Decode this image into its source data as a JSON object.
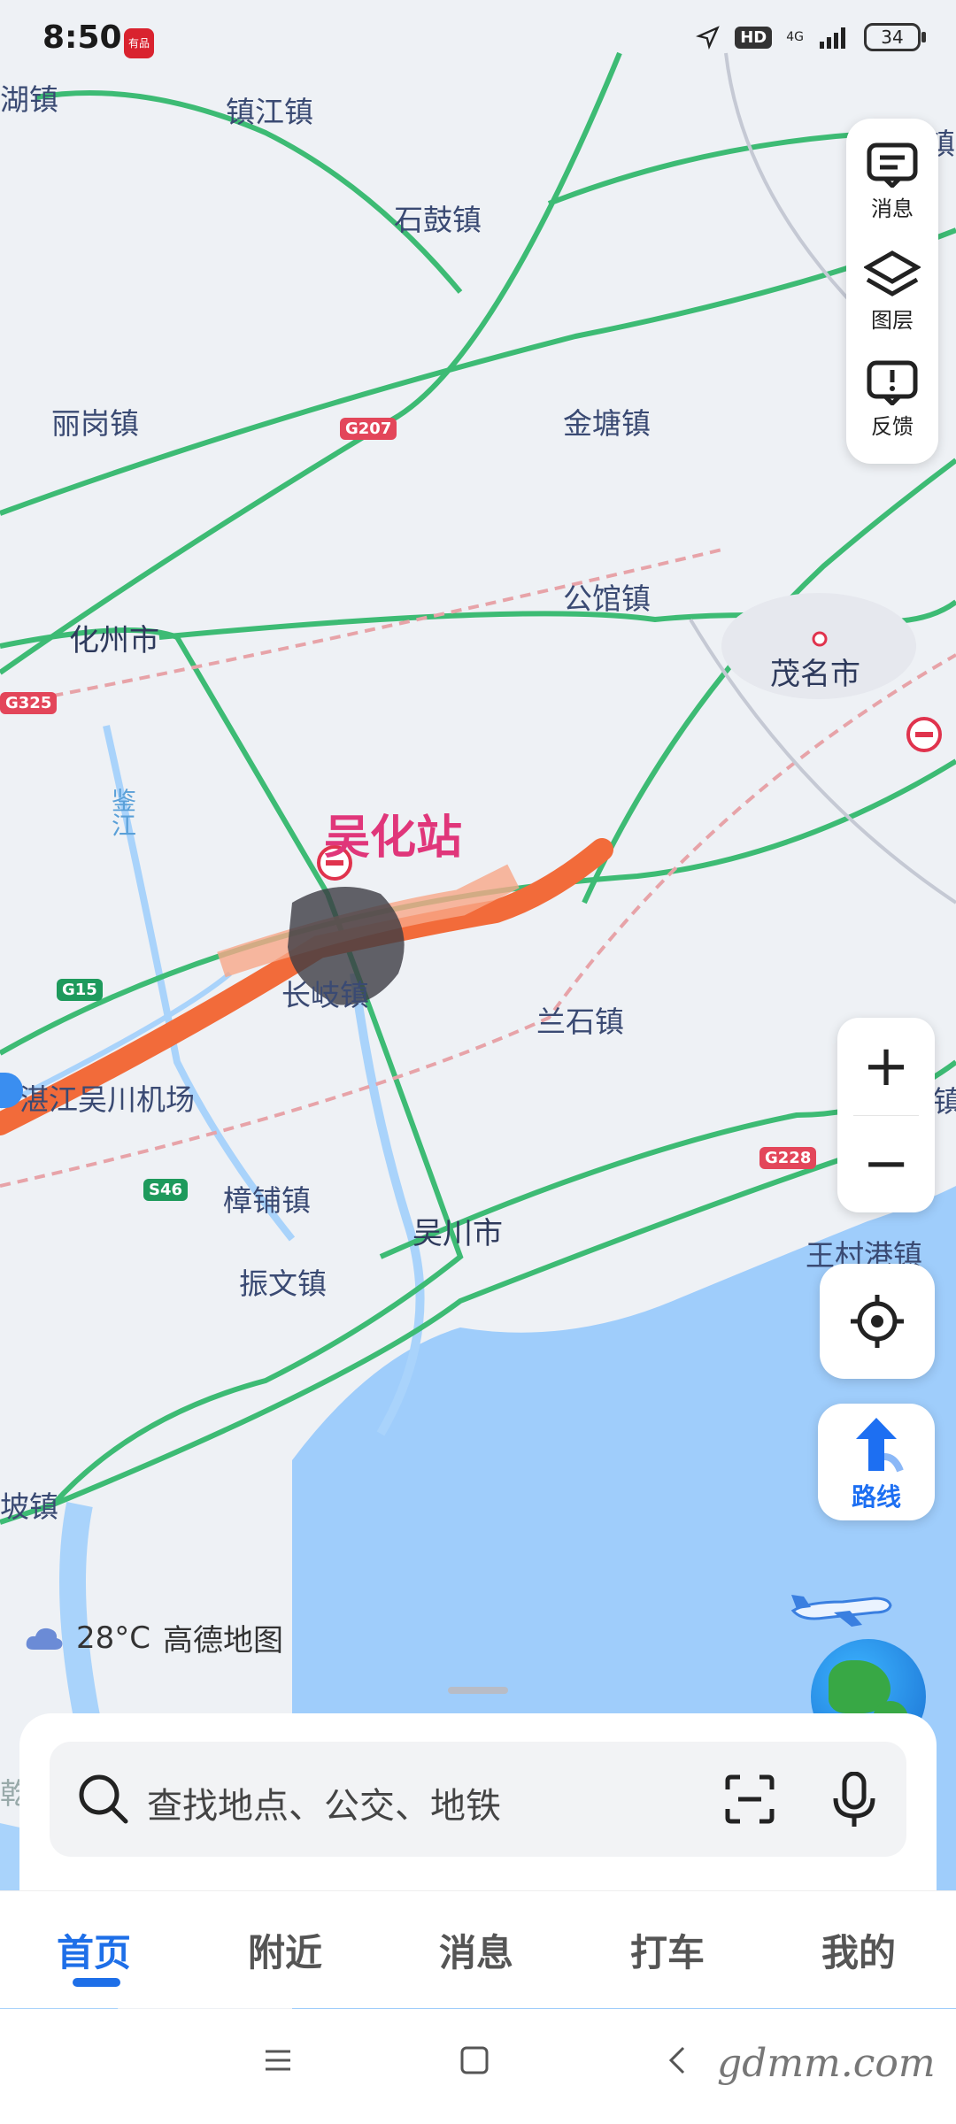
{
  "status_bar": {
    "time": "8:50",
    "app_badge": "有品",
    "network": "4G",
    "hd": "HD",
    "battery": "34"
  },
  "map": {
    "places": {
      "huzhen": "湖镇",
      "zhenjiang": "镇江镇",
      "shigu": "石鼓镇",
      "ligang": "丽岗镇",
      "jintang": "金塘镇",
      "gongguan": "公馆镇",
      "huazhou": "化州市",
      "maoming": "茂名市",
      "jianjiang": "鉴江",
      "changqi": "长岐镇",
      "airport": "湛江吴川机场",
      "lanshi": "兰石镇",
      "zhangpu": "樟铺镇",
      "wuchuan": "吴川市",
      "zhenwen": "振文镇",
      "wangcungang": "王村港镇",
      "po": "坡镇",
      "edge_zhen_top": "镇",
      "edge_zhen_mid": "镇",
      "edge_qian": "乾"
    },
    "station_label": "吴化站",
    "road_shields": {
      "g207": "G207",
      "g325": "G325",
      "g15": "G15",
      "s46": "S46",
      "g228": "G228"
    },
    "route_color": "#f26b3a"
  },
  "side_panel": {
    "messages": "消息",
    "layers": "图层",
    "feedback": "反馈"
  },
  "zoom": {
    "in": "+",
    "out": "−"
  },
  "route_button": "路线",
  "weather": {
    "temp": "28°C",
    "brand": "高德地图"
  },
  "search": {
    "placeholder": "查找地点、公交、地铁"
  },
  "tabs": {
    "home": "首页",
    "nearby": "附近",
    "messages": "消息",
    "taxi": "打车",
    "mine": "我的"
  },
  "watermark": "gdmm.com"
}
